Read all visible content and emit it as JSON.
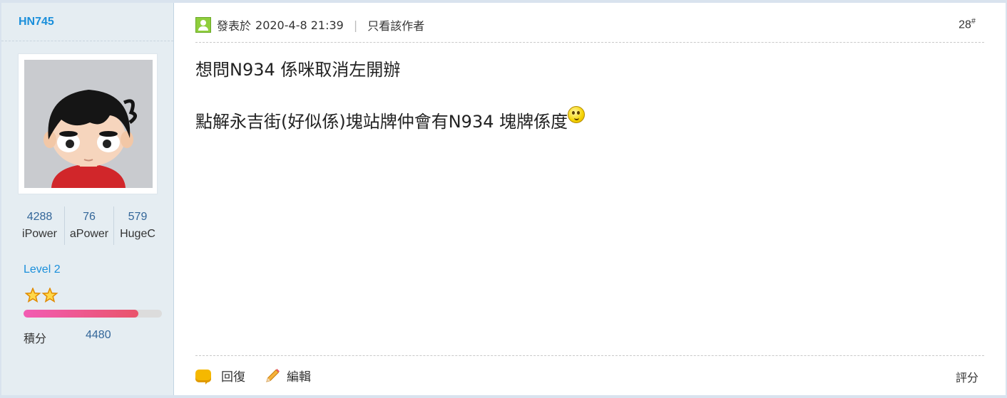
{
  "user": {
    "name": "HN745",
    "stats": [
      {
        "value": "4288",
        "label": "iPower"
      },
      {
        "value": "76",
        "label": "aPower"
      },
      {
        "value": "579",
        "label": "HugeC"
      }
    ],
    "level": "Level 2",
    "stars": "✿✿",
    "level_progress": 0.83,
    "score_label": "積分",
    "score_value": "4480"
  },
  "post": {
    "posted_prefix": "發表於",
    "timestamp": "2020-4-8 21:39",
    "separator": "|",
    "author_only": "只看該作者",
    "floor_number": "28",
    "floor_mark": "#",
    "lines": [
      "想問N934 係咪取消左開辦",
      "點解永吉街(好似係)塊站牌仲會有N934 塊牌係度"
    ],
    "smiley_icon": "smiley-icon"
  },
  "actions": {
    "reply": "回復",
    "edit": "編輯",
    "rate": "評分"
  },
  "colors": {
    "username": "#1a8fdb",
    "sidebar_bg": "#e5edf2",
    "online_icon": "#8fce3c",
    "progress_start": "#f25bb3",
    "progress_end": "#e9546b"
  }
}
